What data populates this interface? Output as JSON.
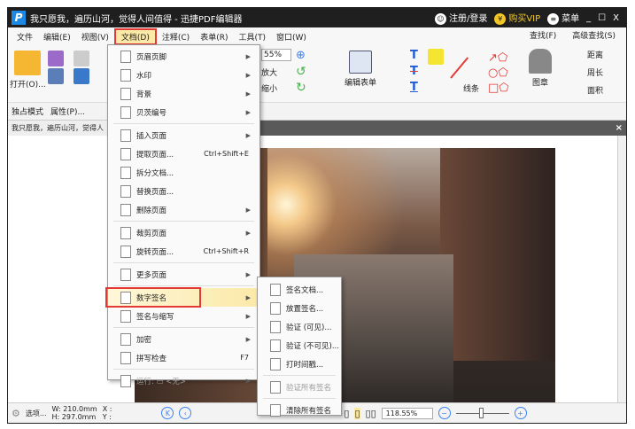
{
  "window": {
    "title": "我只愿我，遍历山河，觉得人间值得 - 迅捷PDF编辑器",
    "login": "注册/登录",
    "vip": "购买VIP",
    "menu": "菜单",
    "minimize": "_",
    "maximize": "☐",
    "close": "X"
  },
  "menubar": {
    "items": [
      "文件",
      "编辑(E)",
      "视图(V)",
      "文档(D)",
      "注释(C)",
      "表单(R)",
      "工具(T)",
      "窗口(W)"
    ],
    "find": "查找(F)",
    "advanced_find": "高级查找(S)"
  },
  "toolbar": {
    "open": "打开(O)...",
    "zoom": "55%",
    "zoom_in": "放大",
    "zoom_out": "缩小",
    "edit_form": "编辑表单",
    "lines": "线条",
    "stamp": "图章",
    "distance": "距离",
    "perimeter": "周长",
    "area": "面积"
  },
  "toolbar2": {
    "exclusive": "独占模式",
    "properties": "属性(P)..."
  },
  "tab": {
    "label": "我只愿我，遍历山河，觉得人",
    "close": "×"
  },
  "doc_menu": {
    "items": [
      {
        "label": "页眉页脚",
        "arrow": true
      },
      {
        "label": "水印",
        "arrow": true
      },
      {
        "label": "背景",
        "arrow": true
      },
      {
        "label": "贝茨编号",
        "arrow": true
      },
      {
        "sep": true
      },
      {
        "label": "插入页面",
        "arrow": true
      },
      {
        "label": "提取页面...",
        "shortcut": "Ctrl+Shift+E"
      },
      {
        "label": "拆分文档..."
      },
      {
        "label": "替换页面..."
      },
      {
        "label": "删除页面",
        "arrow": true
      },
      {
        "sep": true
      },
      {
        "label": "裁剪页面",
        "arrow": true
      },
      {
        "label": "旋转页面...",
        "shortcut": "Ctrl+Shift+R"
      },
      {
        "sep": true
      },
      {
        "label": "更多页面",
        "arrow": true
      },
      {
        "sep": true
      },
      {
        "label": "数字签名",
        "arrow": true,
        "highlighted": true
      },
      {
        "label": "签名与缩写",
        "arrow": true
      },
      {
        "sep": true
      },
      {
        "label": "加密",
        "arrow": true
      },
      {
        "label": "拼写检查",
        "shortcut": "F7"
      },
      {
        "sep": true
      },
      {
        "label": "运行: ▭ <无>",
        "arrow": true,
        "disabled": true
      }
    ]
  },
  "sig_submenu": {
    "items": [
      {
        "label": "签名文档..."
      },
      {
        "label": "放置签名..."
      },
      {
        "label": "验证 (可见)..."
      },
      {
        "label": "验证 (不可见)..."
      },
      {
        "label": "打时间戳..."
      },
      {
        "sep": true
      },
      {
        "label": "验证所有签名",
        "disabled": true
      },
      {
        "sep": true
      },
      {
        "label": "清除所有签名"
      }
    ]
  },
  "status": {
    "options": "选项...",
    "width": "W: 210.0mm",
    "height": "H: 297.0mm",
    "x": "X :",
    "y": "Y :",
    "zoom": "118.55%"
  },
  "colors": {
    "titlebar": "#1f1f1f",
    "highlight_border": "#e53935",
    "vip": "#f3c623",
    "accent": "#3b82f6"
  }
}
